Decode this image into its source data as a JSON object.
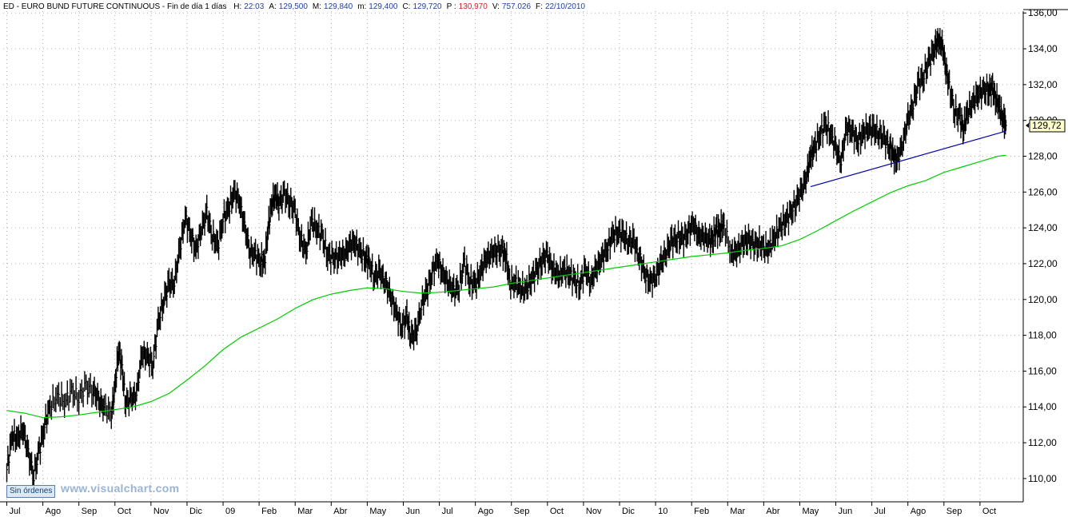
{
  "header": {
    "symbol": "ED - EURO BUND FUTURE CONTINUOUS - Fin de día 1 días",
    "stats": [
      {
        "label": "H:",
        "value": "22:03",
        "color": "#1f3fa0"
      },
      {
        "label": "A:",
        "value": "129,500",
        "color": "#1f3fa0"
      },
      {
        "label": "M:",
        "value": "129,840",
        "color": "#1f3fa0"
      },
      {
        "label": "m:",
        "value": "129,400",
        "color": "#1f3fa0"
      },
      {
        "label": "C:",
        "value": "129,720",
        "color": "#1f3fa0"
      },
      {
        "label": "P :",
        "value": "130,970",
        "color": "#d22020"
      },
      {
        "label": "V:",
        "value": "757.026",
        "color": "#1f3fa0"
      },
      {
        "label": "F:",
        "value": "22/10/2010",
        "color": "#1f3fa0"
      }
    ]
  },
  "badge": "Sin órdenes",
  "watermark": "www.visualchart.com",
  "colors": {
    "price": "#000000",
    "ma": "#00cc00",
    "trendline": "#0000aa",
    "grid": "#b0b0b0",
    "last_price_bg": "#ffffcc"
  },
  "chart_data": {
    "type": "line",
    "title": "",
    "xlabel": "",
    "ylabel": "",
    "x_unit": "trading month index (0 = Jul 2008)",
    "x_ticks": [
      {
        "x": 0,
        "label": "Jul"
      },
      {
        "x": 1,
        "label": "Ago"
      },
      {
        "x": 2,
        "label": "Sep"
      },
      {
        "x": 3,
        "label": "Oct"
      },
      {
        "x": 4,
        "label": "Nov"
      },
      {
        "x": 5,
        "label": "Dic"
      },
      {
        "x": 6,
        "label": "09"
      },
      {
        "x": 7,
        "label": "Feb"
      },
      {
        "x": 8,
        "label": "Mar"
      },
      {
        "x": 9,
        "label": "Abr"
      },
      {
        "x": 10,
        "label": "May"
      },
      {
        "x": 11,
        "label": "Jun"
      },
      {
        "x": 12,
        "label": "Jul"
      },
      {
        "x": 13,
        "label": "Ago"
      },
      {
        "x": 14,
        "label": "Sep"
      },
      {
        "x": 15,
        "label": "Oct"
      },
      {
        "x": 16,
        "label": "Nov"
      },
      {
        "x": 17,
        "label": "Dic"
      },
      {
        "x": 18,
        "label": "10"
      },
      {
        "x": 19,
        "label": "Feb"
      },
      {
        "x": 20,
        "label": "Mar"
      },
      {
        "x": 21,
        "label": "Abr"
      },
      {
        "x": 22,
        "label": "May"
      },
      {
        "x": 23,
        "label": "Jun"
      },
      {
        "x": 24,
        "label": "Jul"
      },
      {
        "x": 25,
        "label": "Ago"
      },
      {
        "x": 26,
        "label": "Sep"
      },
      {
        "x": 27,
        "label": "Oct"
      }
    ],
    "xlim": [
      -0.1,
      28.2
    ],
    "y_ticks": [
      "110,00",
      "112,00",
      "114,00",
      "116,00",
      "118,00",
      "120,00",
      "122,00",
      "124,00",
      "126,00",
      "128,00",
      "130,00",
      "132,00",
      "134,00",
      "136,00"
    ],
    "ylim": [
      108.7,
      136.1
    ],
    "grid": true,
    "log_scale": false,
    "last_price_label": "129,72",
    "last_price_value": 129.72,
    "series": [
      {
        "style": "price-bars",
        "points": [
          [
            0.0,
            110.5
          ],
          [
            0.15,
            112.4
          ],
          [
            0.3,
            112.2
          ],
          [
            0.45,
            112.8
          ],
          [
            0.6,
            111.3
          ],
          [
            0.75,
            110.2
          ],
          [
            0.9,
            111.5
          ],
          [
            1.05,
            113.0
          ],
          [
            1.2,
            114.0
          ],
          [
            1.4,
            114.6
          ],
          [
            1.6,
            114.3
          ],
          [
            1.8,
            114.8
          ],
          [
            2.0,
            114.6
          ],
          [
            2.2,
            115.1
          ],
          [
            2.4,
            115.0
          ],
          [
            2.55,
            114.3
          ],
          [
            2.7,
            114.0
          ],
          [
            2.9,
            113.6
          ],
          [
            3.0,
            115.0
          ],
          [
            3.1,
            117.3
          ],
          [
            3.2,
            116.0
          ],
          [
            3.3,
            114.3
          ],
          [
            3.45,
            114.4
          ],
          [
            3.6,
            114.8
          ],
          [
            3.75,
            117.0
          ],
          [
            3.9,
            116.8
          ],
          [
            4.05,
            116.4
          ],
          [
            4.2,
            118.6
          ],
          [
            4.35,
            120.0
          ],
          [
            4.5,
            120.8
          ],
          [
            4.65,
            121.0
          ],
          [
            4.8,
            122.8
          ],
          [
            4.95,
            124.6
          ],
          [
            5.1,
            123.6
          ],
          [
            5.25,
            122.7
          ],
          [
            5.4,
            124.0
          ],
          [
            5.55,
            124.8
          ],
          [
            5.7,
            123.6
          ],
          [
            5.85,
            122.9
          ],
          [
            6.0,
            124.5
          ],
          [
            6.15,
            125.0
          ],
          [
            6.3,
            126.0
          ],
          [
            6.45,
            125.5
          ],
          [
            6.6,
            124.0
          ],
          [
            6.75,
            122.7
          ],
          [
            6.9,
            122.4
          ],
          [
            7.05,
            122.2
          ],
          [
            7.15,
            122.0
          ],
          [
            7.25,
            124.0
          ],
          [
            7.35,
            125.3
          ],
          [
            7.45,
            125.8
          ],
          [
            7.55,
            125.4
          ],
          [
            7.7,
            125.8
          ],
          [
            7.85,
            125.5
          ],
          [
            8.0,
            124.8
          ],
          [
            8.15,
            123.4
          ],
          [
            8.3,
            122.6
          ],
          [
            8.45,
            124.4
          ],
          [
            8.6,
            124.0
          ],
          [
            8.75,
            123.5
          ],
          [
            8.9,
            122.6
          ],
          [
            9.05,
            122.2
          ],
          [
            9.2,
            122.5
          ],
          [
            9.35,
            122.4
          ],
          [
            9.5,
            123.0
          ],
          [
            9.65,
            123.2
          ],
          [
            9.8,
            122.6
          ],
          [
            9.95,
            122.4
          ],
          [
            10.05,
            122.0
          ],
          [
            10.2,
            121.3
          ],
          [
            10.35,
            121.5
          ],
          [
            10.5,
            121.0
          ],
          [
            10.65,
            120.2
          ],
          [
            10.8,
            119.3
          ],
          [
            10.95,
            118.5
          ],
          [
            11.1,
            119.0
          ],
          [
            11.2,
            118.0
          ],
          [
            11.35,
            118.0
          ],
          [
            11.5,
            119.7
          ],
          [
            11.65,
            120.4
          ],
          [
            11.8,
            121.5
          ],
          [
            11.95,
            122.2
          ],
          [
            12.1,
            121.4
          ],
          [
            12.25,
            121.0
          ],
          [
            12.4,
            120.4
          ],
          [
            12.55,
            120.8
          ],
          [
            12.7,
            122.0
          ],
          [
            12.85,
            121.0
          ],
          [
            13.0,
            120.8
          ],
          [
            13.15,
            121.6
          ],
          [
            13.3,
            122.3
          ],
          [
            13.45,
            122.5
          ],
          [
            13.6,
            122.8
          ],
          [
            13.75,
            122.6
          ],
          [
            13.85,
            122.5
          ],
          [
            13.95,
            120.9
          ],
          [
            14.1,
            121.0
          ],
          [
            14.25,
            120.6
          ],
          [
            14.4,
            120.5
          ],
          [
            14.55,
            121.2
          ],
          [
            14.7,
            121.5
          ],
          [
            14.85,
            122.3
          ],
          [
            15.0,
            122.4
          ],
          [
            15.15,
            121.7
          ],
          [
            15.3,
            121.3
          ],
          [
            15.45,
            121.6
          ],
          [
            15.6,
            121.5
          ],
          [
            15.75,
            121.0
          ],
          [
            15.9,
            120.9
          ],
          [
            16.05,
            121.6
          ],
          [
            16.2,
            121.0
          ],
          [
            16.35,
            121.7
          ],
          [
            16.5,
            122.3
          ],
          [
            16.65,
            122.8
          ],
          [
            16.8,
            123.5
          ],
          [
            16.95,
            123.8
          ],
          [
            17.1,
            123.5
          ],
          [
            17.25,
            123.3
          ],
          [
            17.4,
            123.2
          ],
          [
            17.55,
            122.4
          ],
          [
            17.7,
            121.4
          ],
          [
            17.85,
            121.0
          ],
          [
            18.0,
            121.3
          ],
          [
            18.15,
            122.0
          ],
          [
            18.3,
            122.7
          ],
          [
            18.45,
            123.2
          ],
          [
            18.6,
            123.5
          ],
          [
            18.75,
            123.3
          ],
          [
            18.9,
            123.8
          ],
          [
            19.05,
            124.2
          ],
          [
            19.2,
            123.5
          ],
          [
            19.35,
            123.6
          ],
          [
            19.5,
            123.2
          ],
          [
            19.6,
            123.6
          ],
          [
            19.7,
            123.8
          ],
          [
            19.8,
            124.0
          ],
          [
            19.9,
            124.1
          ],
          [
            20.1,
            122.5
          ],
          [
            20.25,
            122.7
          ],
          [
            20.4,
            123.0
          ],
          [
            20.55,
            123.5
          ],
          [
            20.7,
            123.0
          ],
          [
            20.85,
            123.2
          ],
          [
            21.0,
            122.8
          ],
          [
            21.15,
            122.9
          ],
          [
            21.3,
            123.5
          ],
          [
            21.45,
            124.0
          ],
          [
            21.6,
            124.5
          ],
          [
            21.75,
            124.7
          ],
          [
            21.9,
            125.5
          ],
          [
            22.05,
            126.0
          ],
          [
            22.2,
            127.0
          ],
          [
            22.3,
            128.0
          ],
          [
            22.4,
            128.4
          ],
          [
            22.55,
            129.2
          ],
          [
            22.7,
            129.7
          ],
          [
            22.85,
            129.4
          ],
          [
            23.0,
            128.4
          ],
          [
            23.15,
            127.8
          ],
          [
            23.3,
            129.6
          ],
          [
            23.45,
            129.4
          ],
          [
            23.6,
            128.8
          ],
          [
            23.75,
            129.2
          ],
          [
            23.9,
            129.6
          ],
          [
            24.05,
            129.4
          ],
          [
            24.2,
            129.3
          ],
          [
            24.35,
            128.9
          ],
          [
            24.5,
            128.6
          ],
          [
            24.6,
            128.0
          ],
          [
            24.7,
            127.8
          ],
          [
            24.85,
            128.7
          ],
          [
            25.0,
            130.0
          ],
          [
            25.15,
            131.0
          ],
          [
            25.3,
            132.0
          ],
          [
            25.45,
            132.6
          ],
          [
            25.6,
            133.3
          ],
          [
            25.75,
            134.2
          ],
          [
            25.85,
            134.4
          ],
          [
            25.95,
            134.2
          ],
          [
            26.05,
            133.0
          ],
          [
            26.15,
            131.8
          ],
          [
            26.3,
            130.6
          ],
          [
            26.45,
            130.0
          ],
          [
            26.55,
            129.6
          ],
          [
            26.65,
            130.4
          ],
          [
            26.8,
            131.0
          ],
          [
            26.95,
            131.5
          ],
          [
            27.1,
            131.6
          ],
          [
            27.25,
            131.8
          ],
          [
            27.35,
            131.7
          ],
          [
            27.45,
            131.2
          ],
          [
            27.55,
            130.6
          ],
          [
            27.65,
            130.0
          ],
          [
            27.72,
            129.72
          ]
        ]
      },
      {
        "style": "moving-average",
        "points": [
          [
            0.0,
            113.8
          ],
          [
            0.5,
            113.65
          ],
          [
            1.0,
            113.4
          ],
          [
            1.5,
            113.45
          ],
          [
            2.0,
            113.55
          ],
          [
            2.5,
            113.7
          ],
          [
            3.0,
            113.85
          ],
          [
            3.5,
            114.0
          ],
          [
            4.0,
            114.3
          ],
          [
            4.5,
            114.75
          ],
          [
            5.0,
            115.5
          ],
          [
            5.5,
            116.3
          ],
          [
            6.0,
            117.2
          ],
          [
            6.5,
            117.9
          ],
          [
            7.0,
            118.4
          ],
          [
            7.5,
            118.9
          ],
          [
            8.0,
            119.5
          ],
          [
            8.5,
            120.0
          ],
          [
            9.0,
            120.3
          ],
          [
            9.5,
            120.5
          ],
          [
            10.0,
            120.65
          ],
          [
            10.5,
            120.6
          ],
          [
            11.0,
            120.45
          ],
          [
            11.5,
            120.35
          ],
          [
            12.0,
            120.4
          ],
          [
            12.5,
            120.5
          ],
          [
            13.0,
            120.6
          ],
          [
            13.5,
            120.7
          ],
          [
            14.0,
            120.9
          ],
          [
            14.5,
            121.05
          ],
          [
            15.0,
            121.2
          ],
          [
            15.5,
            121.35
          ],
          [
            16.0,
            121.5
          ],
          [
            16.5,
            121.65
          ],
          [
            17.0,
            121.8
          ],
          [
            17.5,
            121.95
          ],
          [
            18.0,
            122.1
          ],
          [
            18.5,
            122.25
          ],
          [
            19.0,
            122.4
          ],
          [
            19.5,
            122.5
          ],
          [
            20.0,
            122.6
          ],
          [
            20.5,
            122.75
          ],
          [
            21.0,
            122.85
          ],
          [
            21.5,
            123.0
          ],
          [
            22.0,
            123.35
          ],
          [
            22.5,
            123.85
          ],
          [
            23.0,
            124.4
          ],
          [
            23.5,
            124.95
          ],
          [
            24.0,
            125.45
          ],
          [
            24.5,
            125.95
          ],
          [
            25.0,
            126.35
          ],
          [
            25.5,
            126.65
          ],
          [
            26.0,
            127.1
          ],
          [
            26.5,
            127.4
          ],
          [
            27.0,
            127.7
          ],
          [
            27.5,
            128.0
          ],
          [
            27.72,
            128.05
          ]
        ]
      },
      {
        "style": "trendline",
        "points": [
          [
            22.3,
            126.3
          ],
          [
            27.72,
            129.4
          ]
        ]
      }
    ]
  }
}
